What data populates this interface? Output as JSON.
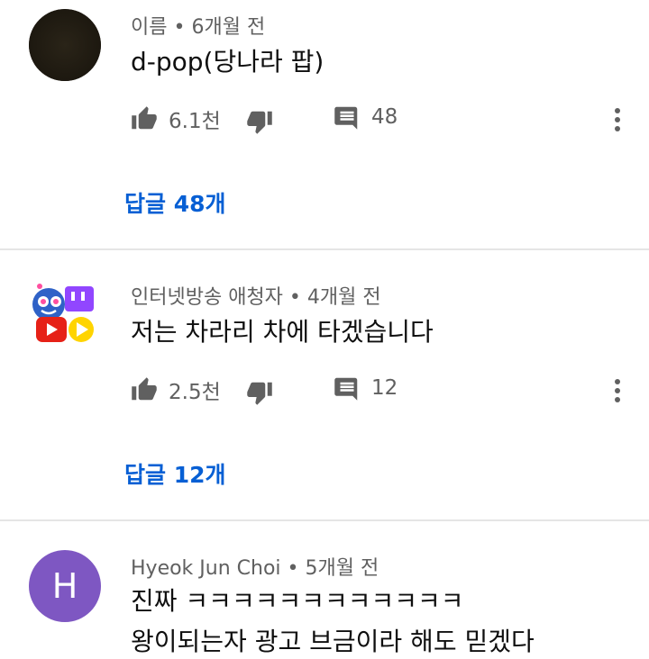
{
  "comments": [
    {
      "author": "이름",
      "time": "6개월 전",
      "lines": [
        "d-pop(당나라 팝)"
      ],
      "likes": "6.1천",
      "reply_count": "48",
      "replies_link": "답글 48개",
      "avatar_color": "#1f1a12"
    },
    {
      "author": "인터넷방송 애청자",
      "time": "4개월 전",
      "lines": [
        "저는 차라리 차에 타겠습니다"
      ],
      "likes": "2.5천",
      "reply_count": "12",
      "replies_link": "답글 12개"
    },
    {
      "author": "Hyeok Jun Choi",
      "time": "5개월 전",
      "lines": [
        "진짜 ㅋㅋㅋㅋㅋㅋㅋㅋㅋㅋㅋㅋ",
        "왕이되는자 광고 브금이라 해도 믿겠다"
      ],
      "avatar_letter": "H",
      "avatar_color": "#7e57c2"
    }
  ],
  "separator": "•",
  "colors": {
    "link": "#065fd4",
    "meta": "#606060",
    "divider": "#e5e5e5"
  }
}
